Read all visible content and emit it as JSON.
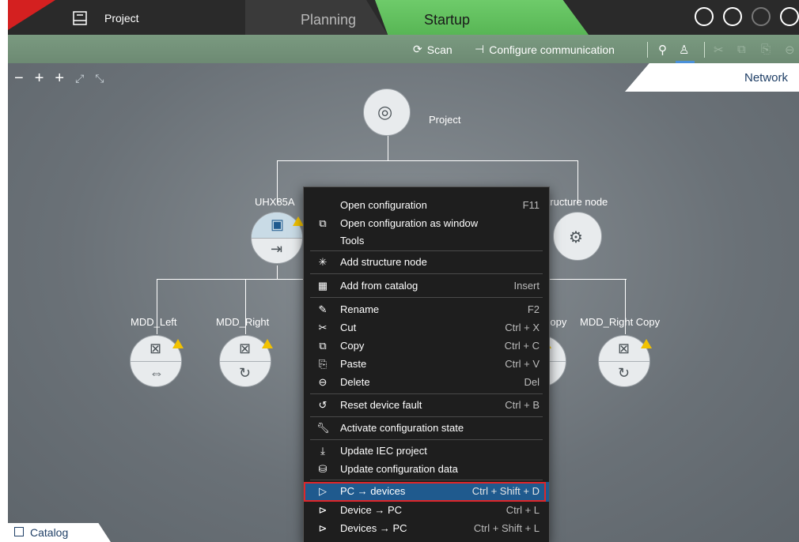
{
  "topbar": {
    "project_label": "Project",
    "tab_planning": "Planning",
    "tab_startup": "Startup"
  },
  "toolbar": {
    "scan_label": "Scan",
    "configure_label": "Configure communication"
  },
  "canvas": {
    "network_tab": "Network",
    "catalog_tab": "Catalog",
    "nodes": {
      "root": "Project",
      "device": "UHX85A",
      "structure": "Structure node",
      "mdd_left": "MDD_Left",
      "mdd_right": "MDD_Right",
      "copy_left_partial": "Copy",
      "mdd_right_copy": "MDD_Right Copy"
    }
  },
  "context_menu": {
    "items": [
      {
        "label": "Open configuration",
        "shortcut": "F11",
        "icon": "none"
      },
      {
        "label": "Open configuration as window",
        "shortcut": "",
        "icon": "window-edit-icon"
      },
      {
        "label": "Tools",
        "shortcut": "",
        "icon": "none"
      },
      {
        "label": "Add structure node",
        "shortcut": "",
        "icon": "add-node-icon"
      },
      {
        "label": "Add from catalog",
        "shortcut": "Insert",
        "icon": "catalog-add-icon"
      },
      {
        "label": "Rename",
        "shortcut": "F2",
        "icon": "pencil-icon"
      },
      {
        "label": "Cut",
        "shortcut": "Ctrl + X",
        "icon": "scissors-icon"
      },
      {
        "label": "Copy",
        "shortcut": "Ctrl + C",
        "icon": "copy-icon"
      },
      {
        "label": "Paste",
        "shortcut": "Ctrl + V",
        "icon": "paste-icon"
      },
      {
        "label": "Delete",
        "shortcut": "Del",
        "icon": "delete-circle-icon"
      },
      {
        "label": "Reset device fault",
        "shortcut": "Ctrl + B",
        "icon": "reset-icon"
      },
      {
        "label": "Activate configuration state",
        "shortcut": "",
        "icon": "wrench-icon"
      },
      {
        "label": "Update IEC project",
        "shortcut": "",
        "icon": "update-iec-icon"
      },
      {
        "label": "Update configuration data",
        "shortcut": "",
        "icon": "update-data-icon"
      },
      {
        "label": "PC → devices",
        "shortcut": "Ctrl + Shift + D",
        "icon": "pc-to-devices-icon",
        "highlighted": true
      },
      {
        "label": "Device → PC",
        "shortcut": "Ctrl + L",
        "icon": "device-to-pc-icon"
      },
      {
        "label": "Devices → PC",
        "shortcut": "Ctrl + Shift + L",
        "icon": "devices-to-pc-icon"
      }
    ]
  },
  "colors": {
    "startup_green": "#5cbf59",
    "highlight_red": "#e0262a",
    "menu_bg": "#1e1e1e",
    "warning_yellow": "#f2c200"
  }
}
